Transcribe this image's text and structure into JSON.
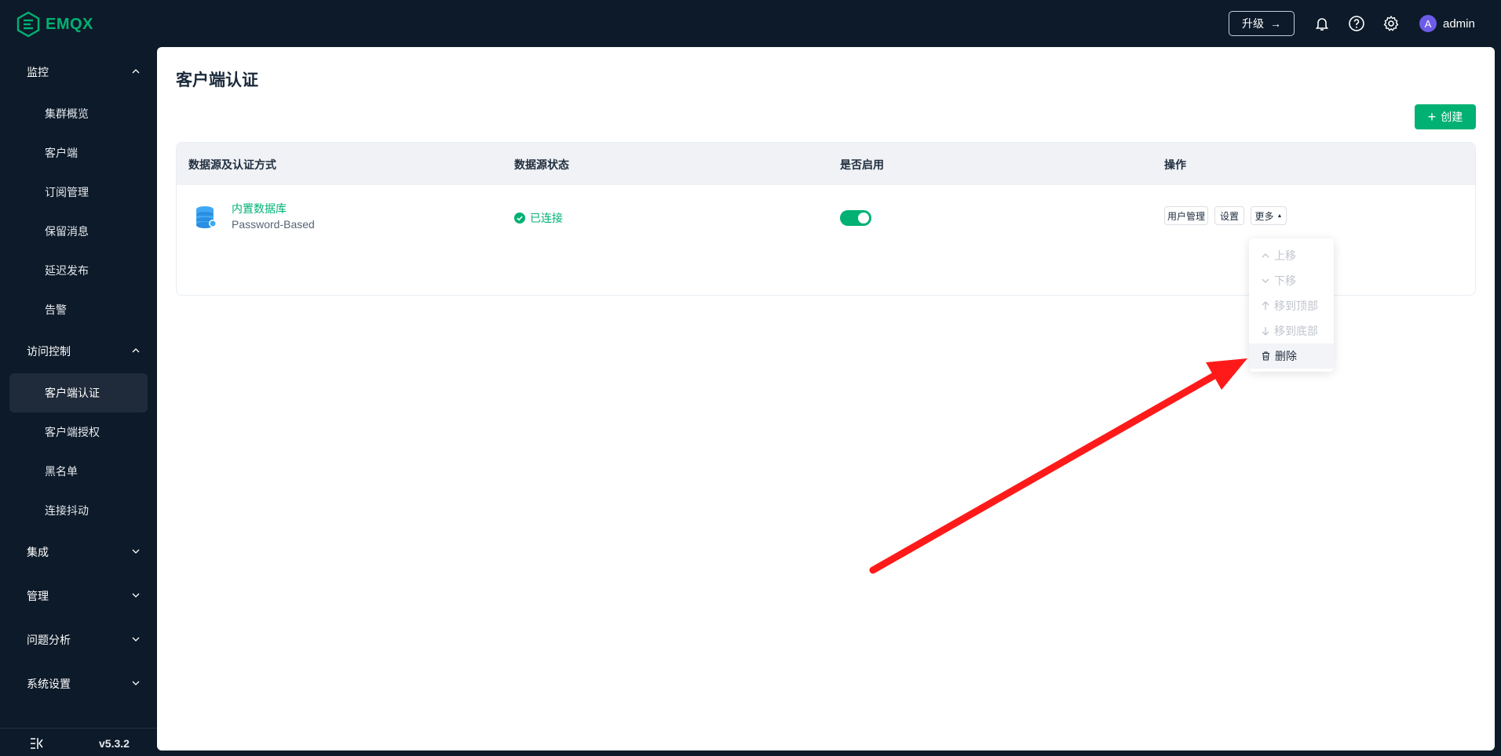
{
  "app": {
    "name": "EMQX"
  },
  "header": {
    "upgrade_label": "升级",
    "user_initial": "A",
    "user_name": "admin"
  },
  "sidebar": {
    "groups": [
      {
        "label": "监控",
        "items": [
          "集群概览",
          "客户端",
          "订阅管理",
          "保留消息",
          "延迟发布",
          "告警"
        ]
      },
      {
        "label": "访问控制",
        "items": [
          "客户端认证",
          "客户端授权",
          "黑名单",
          "连接抖动"
        ]
      },
      {
        "label": "集成"
      },
      {
        "label": "管理"
      },
      {
        "label": "问题分析"
      },
      {
        "label": "系统设置"
      }
    ],
    "active_item": "客户端认证",
    "version": "v5.3.2"
  },
  "main": {
    "title": "客户端认证",
    "create_label": "创建",
    "table": {
      "headers": [
        "数据源及认证方式",
        "数据源状态",
        "是否启用",
        "操作"
      ],
      "rows": [
        {
          "name": "内置数据库",
          "method": "Password-Based",
          "status": "已连接",
          "enabled": true,
          "actions": [
            "用户管理",
            "设置",
            "更多"
          ]
        }
      ]
    },
    "more_menu": [
      {
        "label": "上移",
        "disabled": true
      },
      {
        "label": "下移",
        "disabled": true
      },
      {
        "label": "移到顶部",
        "disabled": true
      },
      {
        "label": "移到底部",
        "disabled": true
      },
      {
        "label": "删除",
        "disabled": false
      }
    ]
  },
  "colors": {
    "accent": "#00b173",
    "sidebar_bg": "#0d1a29",
    "arrow": "#ff1a1a"
  }
}
